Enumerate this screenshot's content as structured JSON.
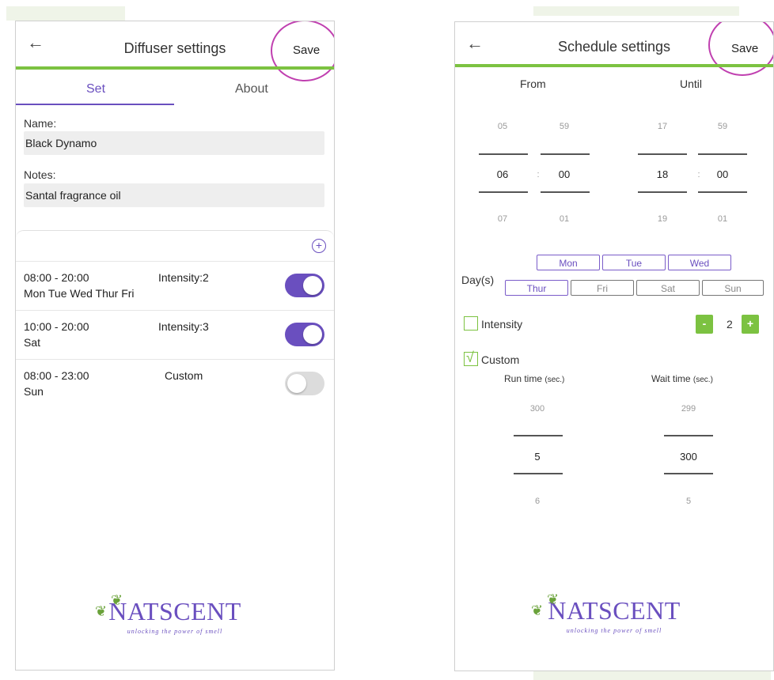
{
  "left": {
    "title": "Diffuser settings",
    "save": "Save",
    "tabs": [
      {
        "label": "Set"
      },
      {
        "label": "About"
      }
    ],
    "name_label": "Name:",
    "name_value": "Black Dynamo",
    "notes_label": "Notes:",
    "notes_value": "Santal fragrance oil",
    "schedules": [
      {
        "time": "08:00 - 20:00",
        "days": "Mon Tue Wed Thur Fri",
        "mode": "Intensity:2",
        "enabled": true
      },
      {
        "time": "10:00 - 20:00",
        "days": "Sat",
        "mode": "Intensity:3",
        "enabled": true
      },
      {
        "time": "08:00 - 23:00",
        "days": "Sun",
        "mode": "Custom",
        "enabled": false
      }
    ],
    "logo": {
      "brand": "NATSCENT",
      "tagline": "unlocking the power of smell"
    }
  },
  "right": {
    "title": "Schedule settings",
    "save": "Save",
    "from_label": "From",
    "until_label": "Until",
    "from_hour": {
      "prev": "05",
      "value": "06",
      "next": "07"
    },
    "from_min": {
      "prev": "59",
      "value": "00",
      "next": "01"
    },
    "until_hour": {
      "prev": "17",
      "value": "18",
      "next": "19"
    },
    "until_min": {
      "prev": "59",
      "value": "00",
      "next": "01"
    },
    "colon": ":",
    "days_label": "Day(s)",
    "days_row1": [
      {
        "label": "Mon",
        "active": true
      },
      {
        "label": "Tue",
        "active": true
      },
      {
        "label": "Wed",
        "active": true
      }
    ],
    "days_row2": [
      {
        "label": "Thur",
        "active": true
      },
      {
        "label": "Fri",
        "active": false
      },
      {
        "label": "Sat",
        "active": false
      },
      {
        "label": "Sun",
        "active": false
      }
    ],
    "intensity_label": "Intensity",
    "intensity_checked": false,
    "intensity_value": "2",
    "minus": "-",
    "plus": "+",
    "custom_label": "Custom",
    "custom_checked": true,
    "check_glyph": "√",
    "run_label": "Run time",
    "wait_label": "Wait time",
    "unit": "(sec.)",
    "run": {
      "prev": "300",
      "value": "5",
      "next": "6"
    },
    "wait": {
      "prev": "299",
      "value": "300",
      "next": "5"
    },
    "logo": {
      "brand": "NATSCENT",
      "tagline": "unlocking the power of smell"
    }
  },
  "colors": {
    "accent_green": "#7cc241",
    "accent_purple": "#6a4fbf",
    "highlight_circle": "#c040b0"
  },
  "icons": {
    "back": "←",
    "add": "+",
    "leaf": "❦"
  }
}
